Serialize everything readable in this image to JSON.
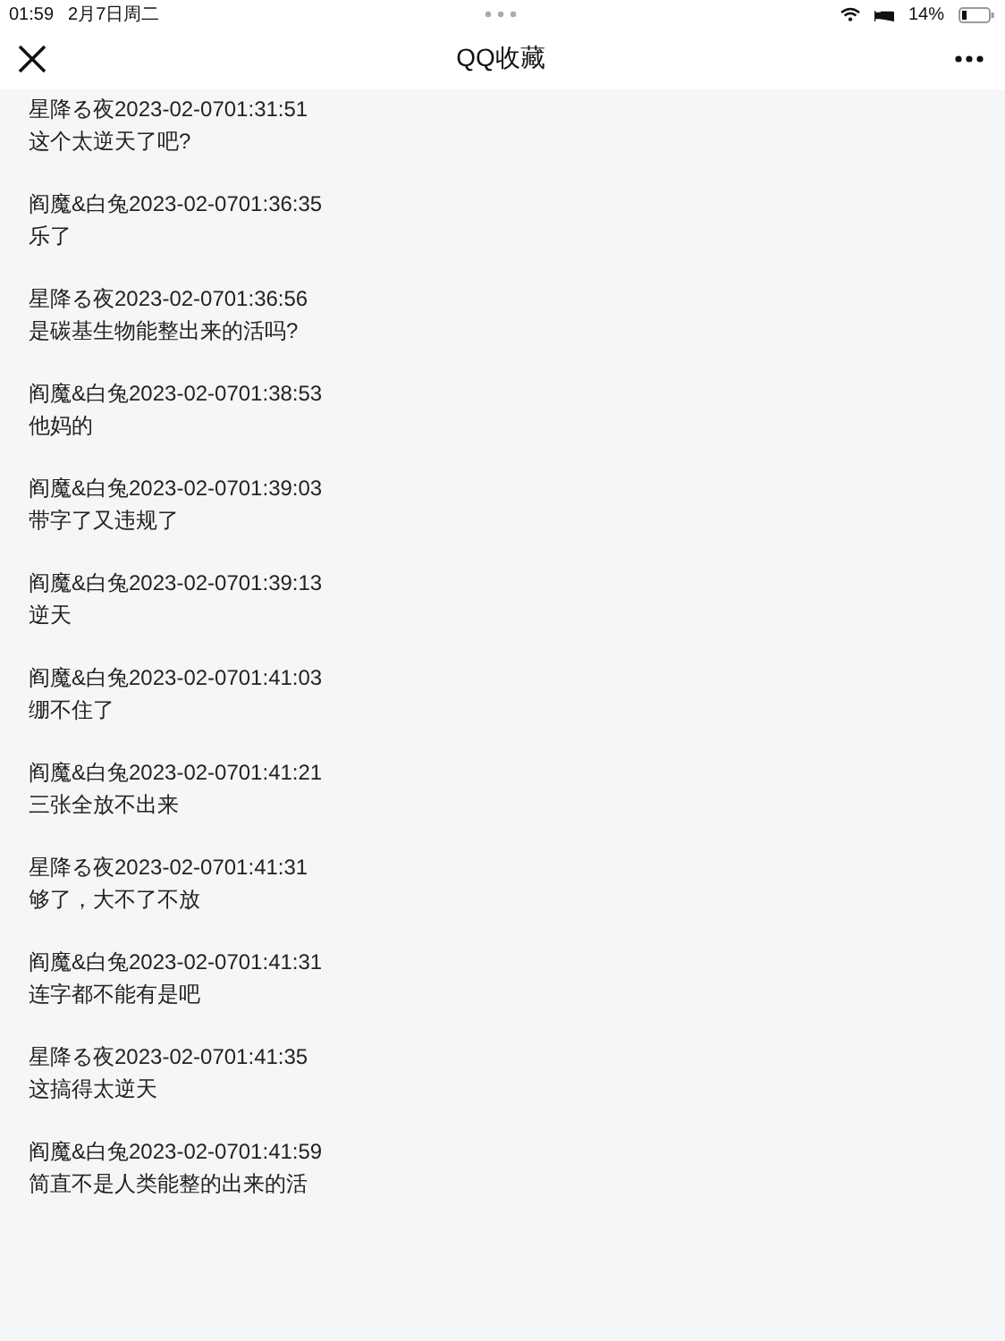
{
  "status_bar": {
    "time": "01:59",
    "date": "2月7日周二",
    "battery": "14%"
  },
  "nav": {
    "title": "QQ收藏"
  },
  "messages": [
    {
      "header": "星降る夜2023-02-0701:31:51",
      "text": "这个太逆天了吧?"
    },
    {
      "header": "阎魔&白兔2023-02-0701:36:35",
      "text": "乐了"
    },
    {
      "header": "星降る夜2023-02-0701:36:56",
      "text": "是碳基生物能整出来的活吗?"
    },
    {
      "header": "阎魔&白兔2023-02-0701:38:53",
      "text": "他妈的"
    },
    {
      "header": "阎魔&白兔2023-02-0701:39:03",
      "text": "带字了又违规了"
    },
    {
      "header": "阎魔&白兔2023-02-0701:39:13",
      "text": "逆天"
    },
    {
      "header": "阎魔&白兔2023-02-0701:41:03",
      "text": "绷不住了"
    },
    {
      "header": "阎魔&白兔2023-02-0701:41:21",
      "text": "三张全放不出来"
    },
    {
      "header": "星降る夜2023-02-0701:41:31",
      "text": "够了，大不了不放"
    },
    {
      "header": "阎魔&白兔2023-02-0701:41:31",
      "text": "连字都不能有是吧"
    },
    {
      "header": "星降る夜2023-02-0701:41:35",
      "text": "这搞得太逆天"
    },
    {
      "header": "阎魔&白兔2023-02-0701:41:59",
      "text": "简直不是人类能整的出来的活"
    }
  ]
}
